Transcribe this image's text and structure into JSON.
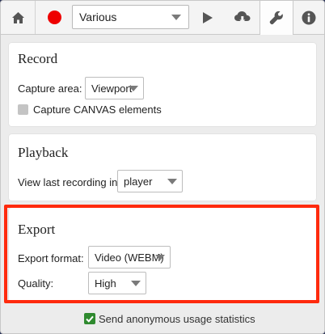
{
  "toolbar": {
    "recording_selector": {
      "value": "Various"
    },
    "icons": {
      "home": "home-icon",
      "record": "record-icon",
      "play": "play-icon",
      "download": "cloud-download-icon",
      "settings": "wrench-icon",
      "info": "info-icon"
    },
    "record_color": "#ee0000"
  },
  "record": {
    "title": "Record",
    "capture_area_label": "Capture area:",
    "capture_area_value": "Viewport",
    "canvas_checkbox_label": "Capture CANVAS elements",
    "canvas_checkbox_checked": false
  },
  "playback": {
    "title": "Playback",
    "view_label": "View last recording in",
    "view_value": "player"
  },
  "export": {
    "title": "Export",
    "format_label": "Export format:",
    "format_value": "Video (WEBM)",
    "quality_label": "Quality:",
    "quality_value": "High",
    "highlight_color": "#ff2a0d"
  },
  "footer": {
    "stats_label": "Send anonymous usage statistics",
    "stats_checked": true,
    "check_color": "#2f8a2f"
  }
}
